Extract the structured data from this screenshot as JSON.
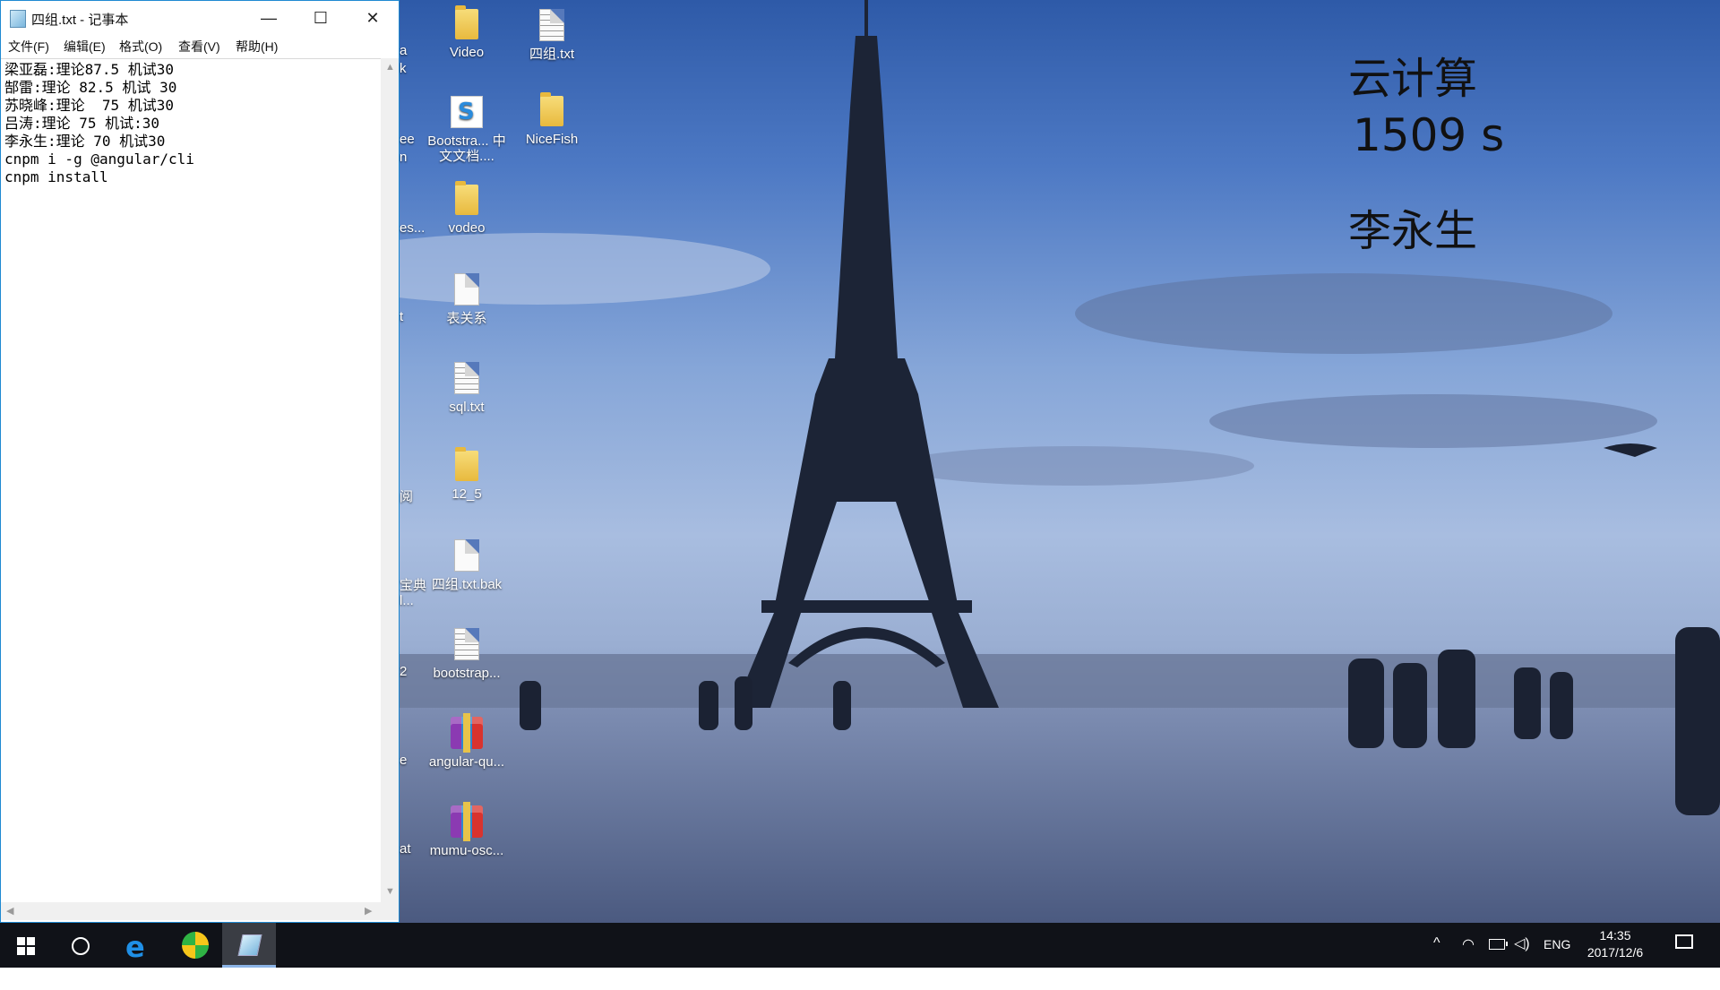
{
  "notepad": {
    "title": "四组.txt - 记事本",
    "window_buttons": {
      "minimize": "—",
      "maximize": "☐",
      "close": "✕"
    },
    "menu": [
      "文件(F)",
      "编辑(E)",
      "格式(O)",
      "查看(V)",
      "帮助(H)"
    ],
    "content_lines": [
      "梁亚磊:理论87.5 机试30",
      "郜雷:理论 82.5 机试 30",
      "苏晓峰:理论  75 机试30",
      "吕涛:理论 75 机试:30",
      "李永生:理论 70 机试30",
      "cnpm i -g @angular/cli",
      "cnpm install"
    ]
  },
  "desktop": {
    "overlay": {
      "title": "云计算",
      "time": "1509 s",
      "name": "李永生"
    },
    "icons": [
      {
        "label": "Video",
        "type": "folder"
      },
      {
        "label": "四组.txt",
        "type": "text-file"
      },
      {
        "label": "Bootstra... 中文文档....",
        "type": "sogou-doc"
      },
      {
        "label": "NiceFish",
        "type": "folder"
      },
      {
        "label": "vodeo",
        "type": "folder"
      },
      {
        "label": "表关系",
        "type": "file"
      },
      {
        "label": "sql.txt",
        "type": "text-file"
      },
      {
        "label": "12_5",
        "type": "folder"
      },
      {
        "label": "四组.txt.bak",
        "type": "file"
      },
      {
        "label": "bootstrap...",
        "type": "text-file"
      },
      {
        "label": "angular-qu...",
        "type": "archive"
      },
      {
        "label": "mumu-osc...",
        "type": "archive"
      }
    ],
    "partial_labels": [
      "a",
      "k",
      "ee",
      "n",
      "es...",
      "t",
      "阅",
      "宝典",
      "l...",
      "2",
      "e",
      "at"
    ]
  },
  "taskbar": {
    "tray": {
      "chevron": "^",
      "language": "ENG",
      "time": "14:35",
      "date": "2017/12/6"
    }
  },
  "colors": {
    "accent": "#1f8ad2",
    "taskbar": "#101218"
  }
}
